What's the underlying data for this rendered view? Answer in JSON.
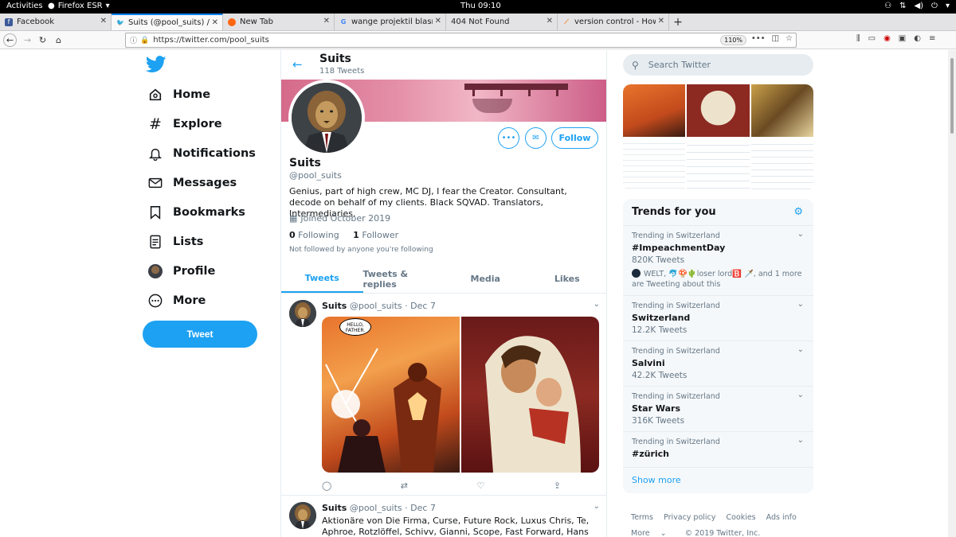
{
  "gnome": {
    "activities": "Activities",
    "app": "Firefox ESR",
    "clock": "Thu 09:10"
  },
  "browser": {
    "tabs": [
      {
        "title": "Facebook",
        "icon": "facebook-icon",
        "color": "#3b5998"
      },
      {
        "title": "Suits (@pool_suits) / Twi",
        "icon": "twitter-icon",
        "color": "#1da1f2"
      },
      {
        "title": "New Tab",
        "icon": "firefox-icon",
        "color": "#ff6611"
      },
      {
        "title": "wange projektil blasrohr",
        "icon": "google-icon",
        "color": "#4285f4"
      },
      {
        "title": "404 Not Found",
        "icon": "",
        "color": ""
      },
      {
        "title": "version control - How ca",
        "icon": "stackoverflow-icon",
        "color": "#f48024"
      }
    ],
    "url": "https://twitter.com/pool_suits",
    "zoom": "110%"
  },
  "nav": {
    "items": [
      {
        "label": "Home",
        "icon": "home-icon"
      },
      {
        "label": "Explore",
        "icon": "hashtag-icon"
      },
      {
        "label": "Notifications",
        "icon": "bell-icon"
      },
      {
        "label": "Messages",
        "icon": "envelope-icon"
      },
      {
        "label": "Bookmarks",
        "icon": "bookmark-icon"
      },
      {
        "label": "Lists",
        "icon": "list-icon"
      },
      {
        "label": "Profile",
        "icon": "avatar-icon"
      },
      {
        "label": "More",
        "icon": "more-circle-icon"
      }
    ],
    "tweet_button": "Tweet"
  },
  "profile": {
    "header_name": "Suits",
    "header_count": "118 Tweets",
    "name": "Suits",
    "handle": "@pool_suits",
    "bio": "Genius, part of high crew, MC DJ, I fear the Creator. Consultant, decode on behalf of my clients. Black SQVAD. Translators, Intermediaries.",
    "joined": "Joined October 2019",
    "following_count": "0",
    "following_label": "Following",
    "followers_count": "1",
    "followers_label": "Follower",
    "not_followed": "Not followed by anyone you're following",
    "follow_button": "Follow"
  },
  "tabs": [
    "Tweets",
    "Tweets & replies",
    "Media",
    "Likes"
  ],
  "tweets": [
    {
      "name": "Suits",
      "handle": "@pool_suits",
      "date": "Dec 7",
      "speech": "HELLO, FATHER."
    },
    {
      "name": "Suits",
      "handle": "@pool_suits",
      "date": "Dec 7",
      "text": "Aktionäre von Die Firma, Curse, Future Rock, Luxus Chris, Te, Aphroe, Rotzlöffel, Schivv, Gianni, Scope, Fast Forward, Hans Sølo"
    }
  ],
  "search": {
    "placeholder": "Search Twitter"
  },
  "trends": {
    "title": "Trends for you",
    "items": [
      {
        "context": "Trending in Switzerland",
        "name": "#ImpeachmentDay",
        "count": "820K Tweets",
        "extra_prefix": "WELT, ",
        "extra_emoji": "🐬🍄🌵loser lord🅱️ 🗡️, ",
        "extra_suffix": "and 1 more are Tweeting about this"
      },
      {
        "context": "Trending in Switzerland",
        "name": "Switzerland",
        "count": "12.2K Tweets"
      },
      {
        "context": "Trending in Switzerland",
        "name": "Salvini",
        "count": "42.2K Tweets"
      },
      {
        "context": "Trending in Switzerland",
        "name": "Star Wars",
        "count": "316K Tweets"
      },
      {
        "context": "Trending in Switzerland",
        "name": "#zürich",
        "count": ""
      }
    ],
    "show_more": "Show more"
  },
  "footer": {
    "terms": "Terms",
    "privacy": "Privacy policy",
    "cookies": "Cookies",
    "ads": "Ads info",
    "more": "More",
    "copyright": "© 2019 Twitter, Inc."
  }
}
